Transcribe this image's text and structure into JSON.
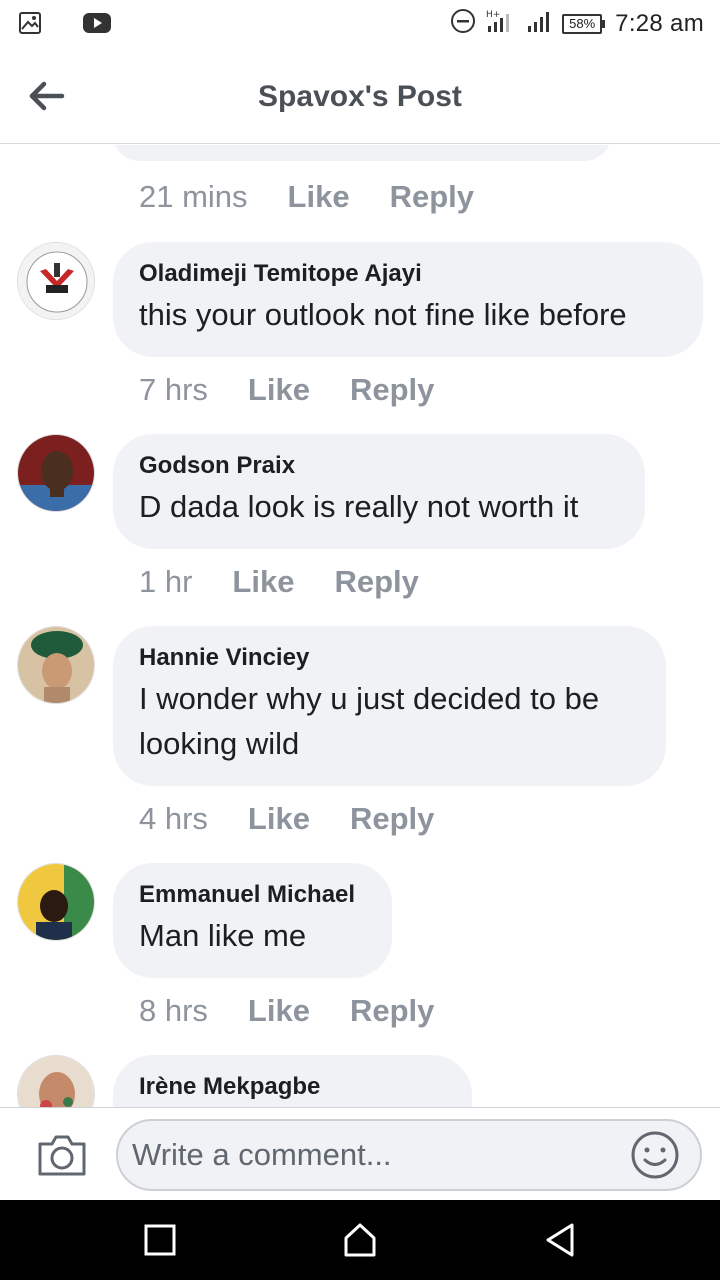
{
  "status_bar": {
    "time": "7:28 am",
    "battery": "58%",
    "icons": [
      "image-icon",
      "youtube-icon",
      "dnd-icon",
      "signal-icon",
      "signal-icon-2",
      "battery-icon"
    ]
  },
  "header": {
    "title": "Spavox's Post"
  },
  "previous_comment_meta": {
    "time": "21 mins",
    "like": "Like",
    "reply": "Reply"
  },
  "comments": [
    {
      "author": "Oladimeji Temitope Ajayi",
      "lines": [
        "this your outlook not fine like before"
      ],
      "time": "7 hrs",
      "like": "Like",
      "reply": "Reply"
    },
    {
      "author": "Godson Praix",
      "lines": [
        "D dada look is really not worth it"
      ],
      "time": "1 hr",
      "like": "Like",
      "reply": "Reply"
    },
    {
      "author": "Hannie Vinciey",
      "lines": [
        "I wonder why u just decided to be",
        "looking wild"
      ],
      "time": "4 hrs",
      "like": "Like",
      "reply": "Reply"
    },
    {
      "author": "Emmanuel Michael",
      "lines": [
        "Man like me"
      ],
      "time": "8 hrs",
      "like": "Like",
      "reply": "Reply"
    },
    {
      "author": "Irène Mekpagbe"
    }
  ],
  "composer": {
    "placeholder": "Write a comment..."
  },
  "colors": {
    "bubble": "#f0f2f5",
    "meta": "#8d949e",
    "title": "#4b4f56"
  }
}
